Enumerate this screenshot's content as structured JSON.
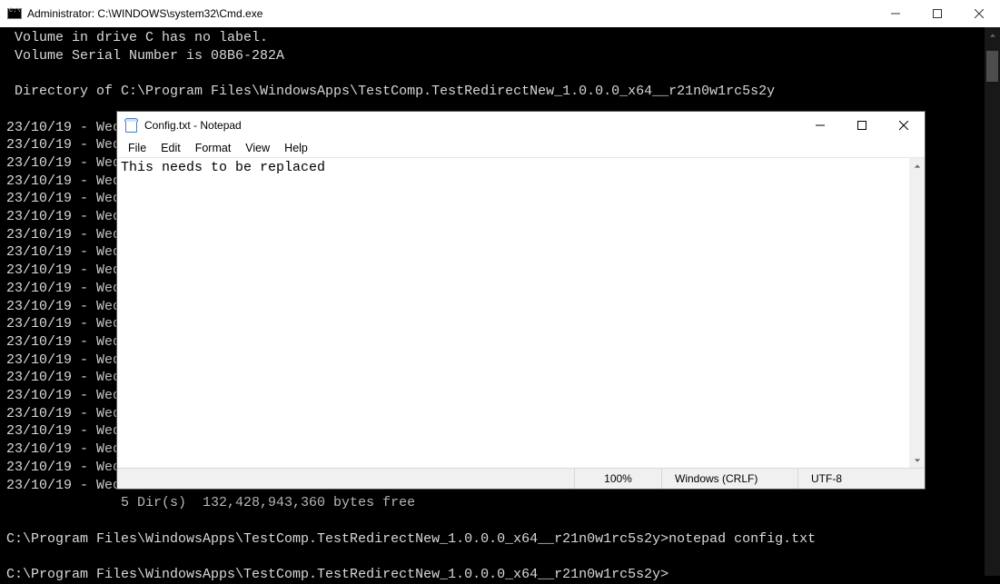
{
  "cmd": {
    "title": "Administrator: C:\\WINDOWS\\system32\\Cmd.exe",
    "lines": [
      " Volume in drive C has no label.",
      " Volume Serial Number is 08B6-282A",
      "",
      " Directory of C:\\Program Files\\WindowsApps\\TestComp.TestRedirectNew_1.0.0.0_x64__r21n0w1rc5s2y",
      "",
      "23/10/19 - Wed",
      "23/10/19 - Wed",
      "23/10/19 - Wed",
      "23/10/19 - Wed",
      "23/10/19 - Wed",
      "23/10/19 - Wed",
      "23/10/19 - Wed",
      "23/10/19 - Wed",
      "23/10/19 - Wed",
      "23/10/19 - Wed",
      "23/10/19 - Wed",
      "23/10/19 - Wed",
      "23/10/19 - Wed",
      "23/10/19 - Wed",
      "23/10/19 - Wed",
      "23/10/19 - Wed",
      "23/10/19 - Wed",
      "23/10/19 - Wed",
      "23/10/19 - Wed",
      "23/10/19 - Wed",
      "23/10/19 - Wed",
      "              5 Dir(s)  132,428,943,360 bytes free",
      "",
      "C:\\Program Files\\WindowsApps\\TestComp.TestRedirectNew_1.0.0.0_x64__r21n0w1rc5s2y>notepad config.txt",
      "",
      "C:\\Program Files\\WindowsApps\\TestComp.TestRedirectNew_1.0.0.0_x64__r21n0w1rc5s2y>"
    ]
  },
  "notepad": {
    "title": "Config.txt - Notepad",
    "menu": {
      "file": "File",
      "edit": "Edit",
      "format": "Format",
      "view": "View",
      "help": "Help"
    },
    "content": "This needs to be replaced",
    "status": {
      "zoom": "100%",
      "eol": "Windows (CRLF)",
      "enc": "UTF-8"
    }
  }
}
